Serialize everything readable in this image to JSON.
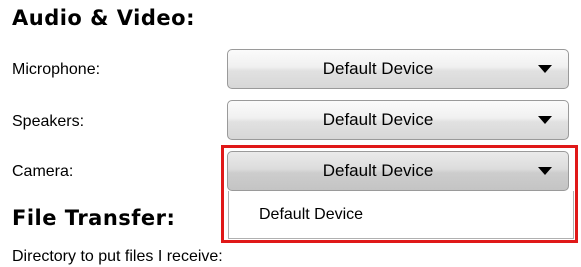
{
  "audio_video": {
    "title": "Audio & Video:",
    "microphone": {
      "label": "Microphone:",
      "selected": "Default Device"
    },
    "speakers": {
      "label": "Speakers:",
      "selected": "Default Device"
    },
    "camera": {
      "label": "Camera:",
      "selected": "Default Device",
      "options": [
        "Default Device"
      ]
    }
  },
  "file_transfer": {
    "title": "File Transfer:",
    "directory_label": "Directory to put files I receive:"
  },
  "colors": {
    "highlight_border": "#e01818",
    "dropdown_border": "#9a9a9a"
  },
  "icons": {
    "dropdown_arrow": "chevron-down-icon"
  }
}
